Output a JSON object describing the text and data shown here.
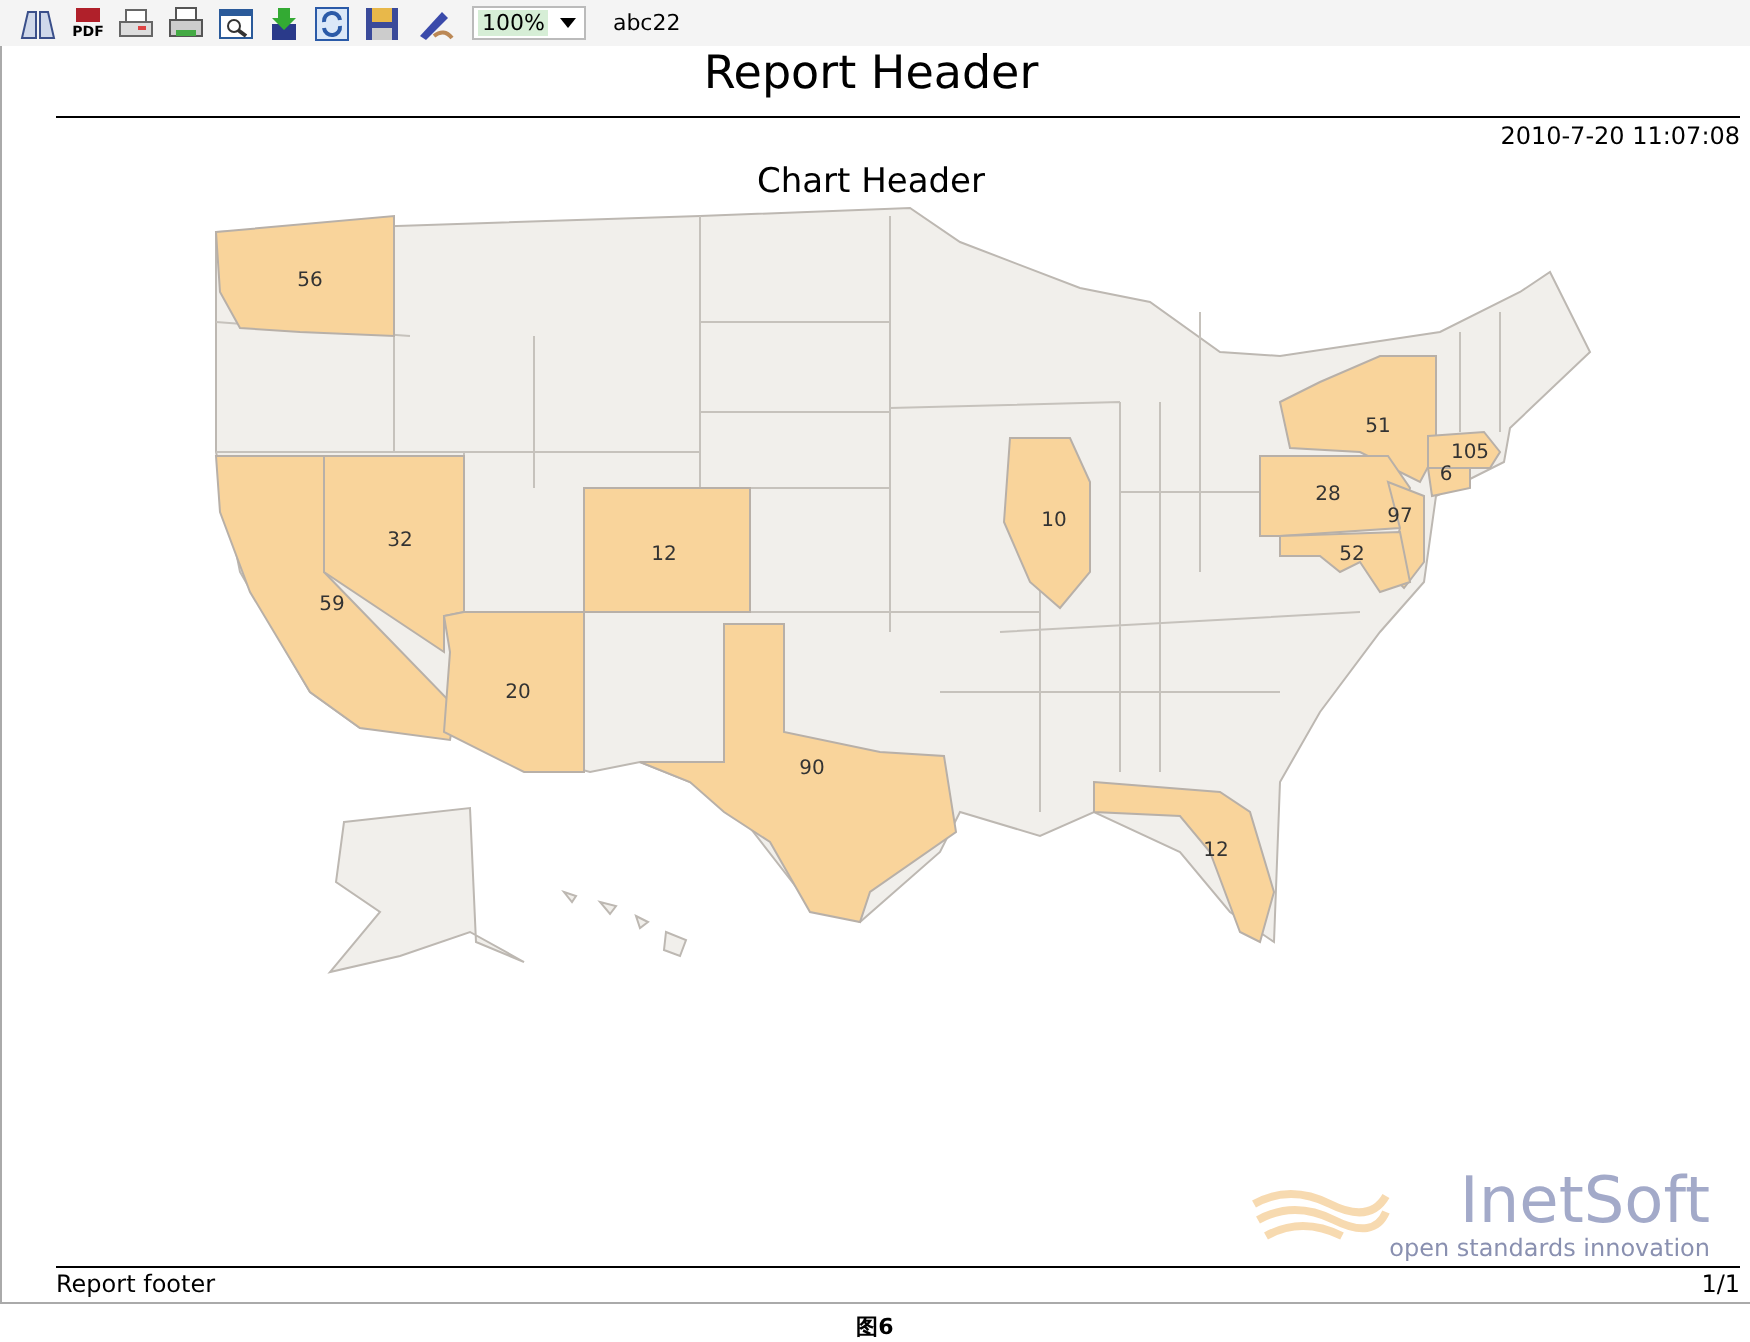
{
  "toolbar": {
    "pdf_label": "PDF",
    "zoom": {
      "value": "100%"
    },
    "user": "abc22"
  },
  "report": {
    "header": "Report Header",
    "timestamp": "2010-7-20 11:07:08",
    "chart_header": "Chart Header",
    "map": {
      "regions": [
        {
          "label": "56",
          "highlighted": true
        },
        {
          "label": "59",
          "highlighted": true
        },
        {
          "label": "32",
          "highlighted": true
        },
        {
          "label": "20",
          "highlighted": true
        },
        {
          "label": "12",
          "highlighted": true
        },
        {
          "label": "90",
          "highlighted": true
        },
        {
          "label": "10",
          "highlighted": true
        },
        {
          "label": "12",
          "highlighted": true
        },
        {
          "label": "51",
          "highlighted": true
        },
        {
          "label": "28",
          "highlighted": true
        },
        {
          "label": "97",
          "highlighted": true
        },
        {
          "label": "52",
          "highlighted": true
        },
        {
          "label": "105",
          "highlighted": true
        },
        {
          "label": "6",
          "highlighted": true
        }
      ]
    },
    "footer": "Report footer",
    "page": "1/1",
    "logo": {
      "name": "InetSoft",
      "tagline": "open standards innovation"
    }
  },
  "caption": "图6"
}
